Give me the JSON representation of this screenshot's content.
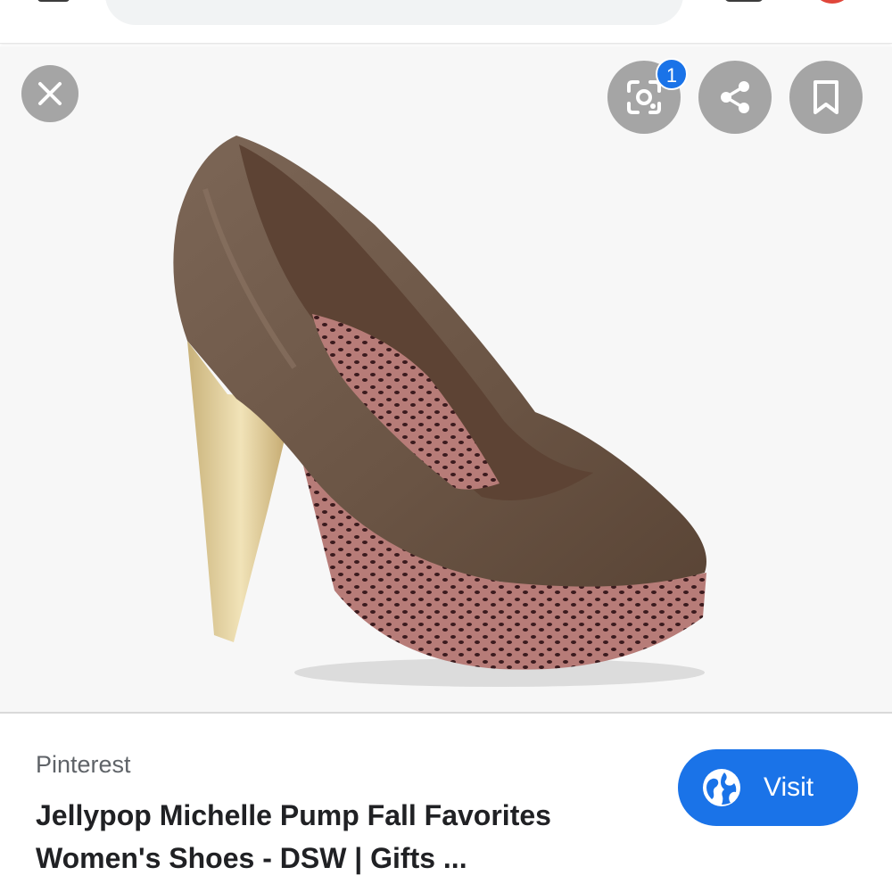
{
  "viewer": {
    "badge_count": "1"
  },
  "result": {
    "source": "Pinterest",
    "title_line1": "Jellypop Michelle Pump Fall Favorites",
    "title_line2": "Women's Shoes - DSW | Gifts ..."
  },
  "actions": {
    "visit_label": "Visit"
  },
  "colors": {
    "accent": "#1a73e8",
    "button_overlay": "#969696",
    "shoe_leather": "#6e5848",
    "heel_gold": "#d9c490",
    "platform_print": "#8a4a48"
  },
  "icons": {
    "close": "close-icon",
    "lens": "lens-search-icon",
    "share": "share-icon",
    "save": "bookmark-icon",
    "visit": "globe-icon"
  }
}
